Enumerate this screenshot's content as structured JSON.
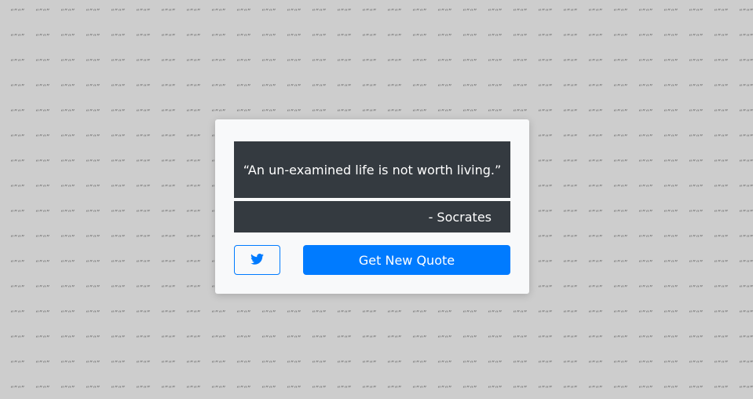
{
  "background": {
    "color": "#cdcdcd",
    "pattern_glyph": "“”“”"
  },
  "quote": {
    "text": "“An un-examined life is not worth living.”",
    "author": "- Socrates"
  },
  "buttons": {
    "tweet_icon": "twitter-icon",
    "new_quote_label": "Get New Quote"
  },
  "colors": {
    "card_bg": "#f8f9fa",
    "quote_bg": "#343a40",
    "primary": "#007bff"
  }
}
